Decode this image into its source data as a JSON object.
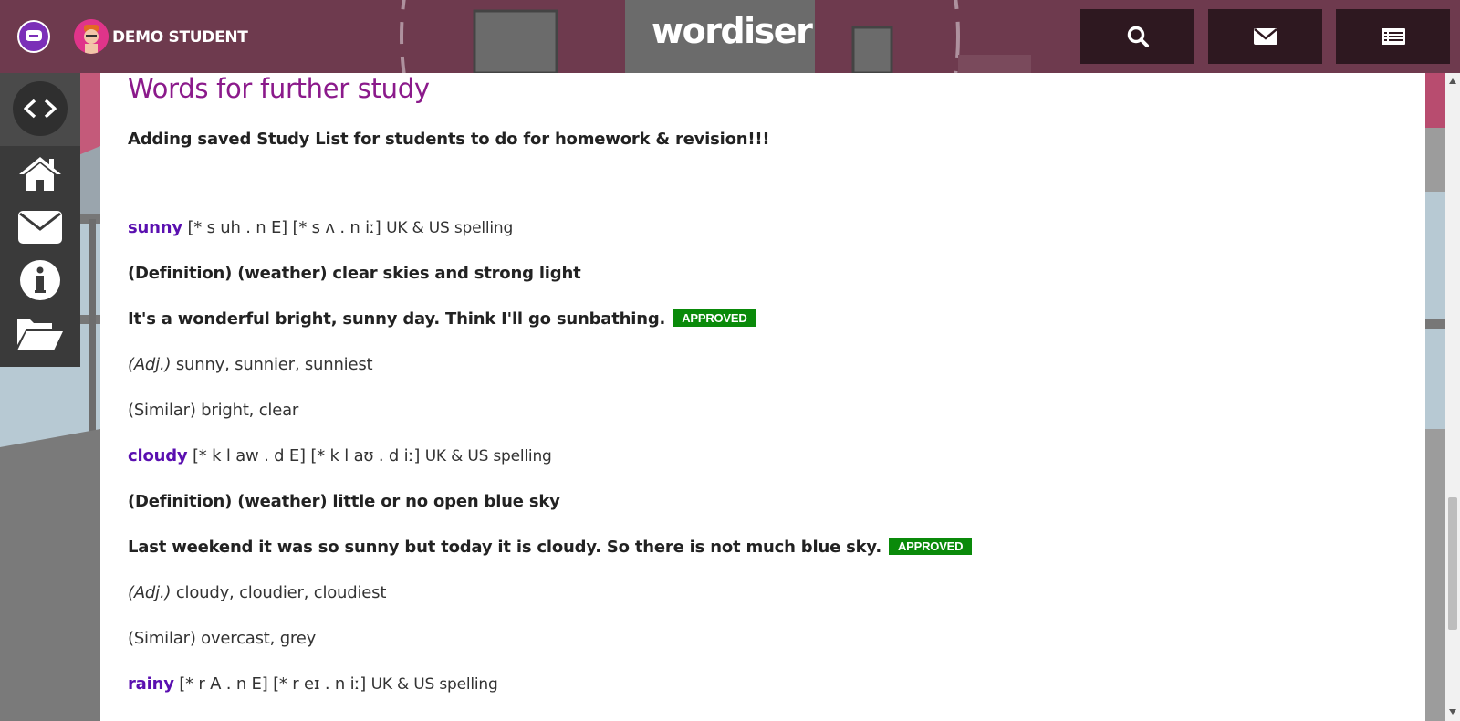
{
  "header": {
    "user_name": "DEMO STUDENT",
    "brand": "wordiser",
    "buttons": [
      {
        "icon": "search-icon"
      },
      {
        "icon": "envelope-icon"
      },
      {
        "icon": "list-icon"
      }
    ]
  },
  "sidebar": {
    "toggle_icon": "code-icon",
    "items": [
      {
        "icon": "home-icon"
      },
      {
        "icon": "envelope-icon"
      },
      {
        "icon": "info-icon"
      },
      {
        "icon": "folder-open-icon"
      }
    ]
  },
  "page": {
    "title": "Words for further study",
    "intro": "Adding saved Study List for students to do for homework & revision!!!"
  },
  "entries": [
    {
      "word": "sunny",
      "pron1": "[* s uh . n E]",
      "pron2": "[* s ʌ . n iː]",
      "spelling": "UK & US spelling",
      "definition": "(Definition) (weather) clear skies and strong light",
      "example": "It's a wonderful bright, sunny day. Think I'll go sunbathing.",
      "badge": "APPROVED",
      "pos": "(Adj.)",
      "forms": "sunny, sunnier, sunniest",
      "similar": "(Similar) bright, clear"
    },
    {
      "word": "cloudy",
      "pron1": "[* k l aw . d E]",
      "pron2": "[* k l aʊ . d iː]",
      "spelling": "UK & US spelling",
      "definition": "(Definition) (weather) little or no open blue sky",
      "example": "Last weekend it was so sunny but today it is cloudy. So there is not much blue sky.",
      "badge": "APPROVED",
      "pos": "(Adj.)",
      "forms": "cloudy, cloudier, cloudiest",
      "similar": "(Similar) overcast, grey"
    },
    {
      "word": "rainy",
      "pron1": "[* r A . n E]",
      "pron2": "[* r eɪ . n iː]",
      "spelling": "UK & US spelling"
    }
  ],
  "colors": {
    "header": "#6e3a4e",
    "header_button": "#2e1820",
    "title": "#8b1a8b",
    "word": "#5a0fb0",
    "badge": "#0a8a0a",
    "sidebar": "#3a3a3a"
  }
}
